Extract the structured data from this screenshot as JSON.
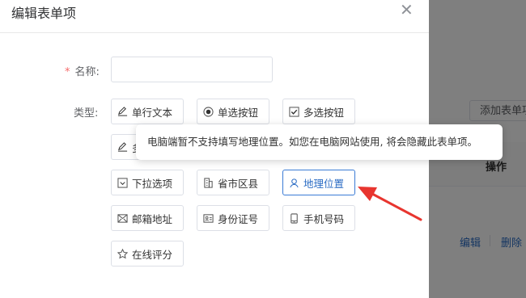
{
  "dialog": {
    "title": "编辑表单项"
  },
  "form": {
    "name_label": "名称:",
    "name_value": "",
    "type_label": "类型:"
  },
  "types": {
    "single_text": "单行文本",
    "radio": "单选按钮",
    "checkbox": "多选按钮",
    "multi_text_partial": "多",
    "dropdown": "下拉选项",
    "province": "省市区县",
    "geo": "地理位置",
    "postal": "邮箱地址",
    "idcard": "身份证号",
    "phone": "手机号码",
    "rating": "在线评分"
  },
  "tooltip": {
    "text": "电脑端暂不支持填写地理位置。如您在电脑网站使用, 将会隐藏此表单项。"
  },
  "background": {
    "add_button": "添加表单项",
    "column_operation": "操作",
    "edit_link": "编辑",
    "delete_link": "删除"
  },
  "colors": {
    "accent": "#2b6cc4",
    "arrow": "#e8352f",
    "overlay": "#7f7f7f"
  }
}
